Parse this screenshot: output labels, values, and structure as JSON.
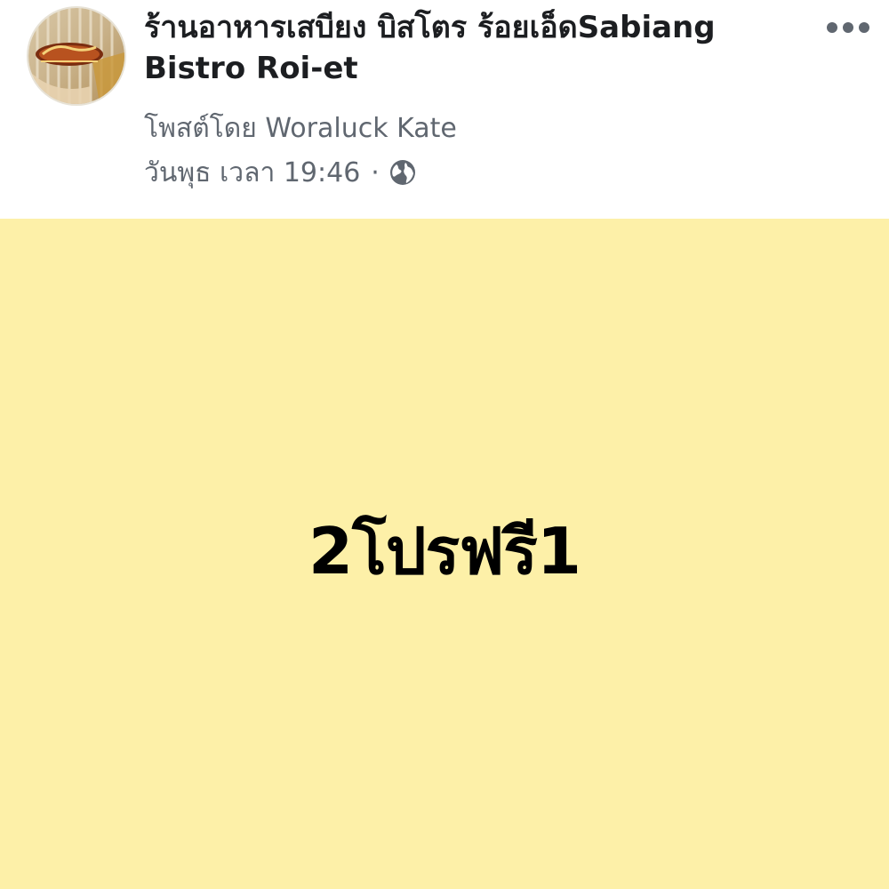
{
  "post": {
    "page_name": "ร้านอาหารเสบียง บิสโตร ร้อยเอ็ดSabiang Bistro Roi-et",
    "posted_by": "โพสต์โดย Woraluck Kate",
    "time": "วันพุธ เวลา 19:46",
    "separator": "·",
    "privacy_icon": "globe-icon",
    "more_icon": "more-options-icon",
    "body_text": "2โปรฟรี1",
    "background_color": "#fdf0a8"
  }
}
